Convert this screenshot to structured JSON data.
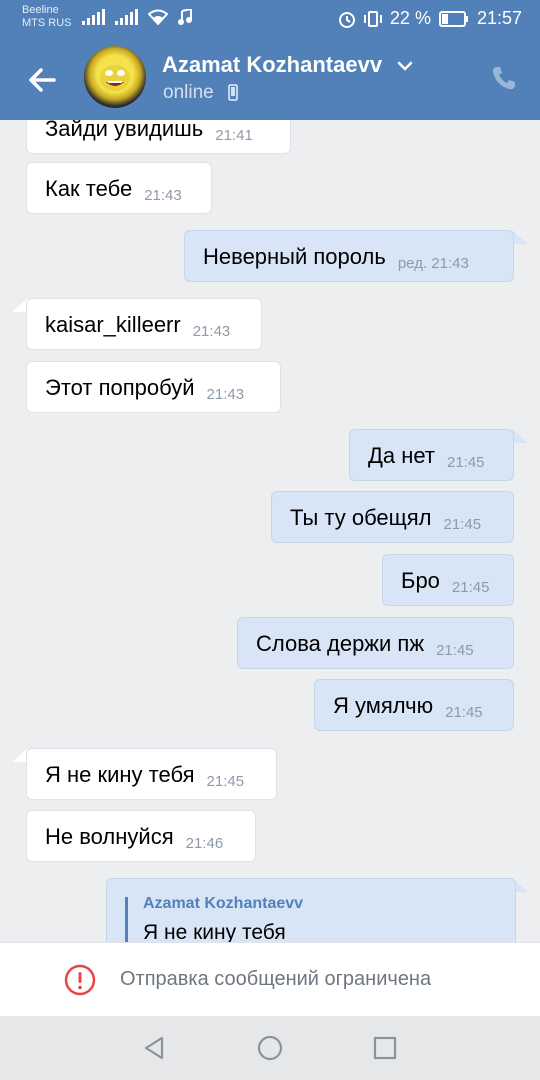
{
  "status_bar": {
    "carrier_1": "Beeline",
    "carrier_2": "MTS RUS",
    "battery": "22 %",
    "time": "21:57"
  },
  "header": {
    "contact_name": "Azamat Kozhantaevv",
    "status": "online",
    "icons": [
      "back-arrow-icon",
      "chevron-down-icon",
      "mobile-icon",
      "phone-icon"
    ]
  },
  "messages": [
    {
      "dir": "in",
      "text": "Зайди увидишь",
      "time": "21:41"
    },
    {
      "dir": "in",
      "text": "Как тебе",
      "time": "21:43"
    },
    {
      "dir": "out",
      "text": "Неверный пороль",
      "time": "ред. 21:43"
    },
    {
      "dir": "in",
      "text": "kaisar_killeerr",
      "time": "21:43"
    },
    {
      "dir": "in",
      "text": "Этот попробуй",
      "time": "21:43"
    },
    {
      "dir": "out",
      "text": "Да нет",
      "time": "21:45"
    },
    {
      "dir": "out",
      "text": "Ты ту обещял",
      "time": "21:45"
    },
    {
      "dir": "out",
      "text": "Бро",
      "time": "21:45"
    },
    {
      "dir": "out",
      "text": "Слова держи пж",
      "time": "21:45"
    },
    {
      "dir": "out",
      "text": "Я умялчю",
      "time": "21:45"
    },
    {
      "dir": "in",
      "text": "Я не кину тебя",
      "time": "21:45"
    },
    {
      "dir": "in",
      "text": "Не волнуйся",
      "time": "21:46"
    }
  ],
  "reply": {
    "author": "Azamat Kozhantaevv",
    "quoted_text": "Я не кину тебя"
  },
  "restricted": {
    "text": "Отправка сообщений ограничена"
  },
  "colors": {
    "header": "#5181b8",
    "incoming_bubble": "#ffffff",
    "outgoing_bubble": "#d7e5f7",
    "background": "#edeef0",
    "warning": "#e64646"
  }
}
